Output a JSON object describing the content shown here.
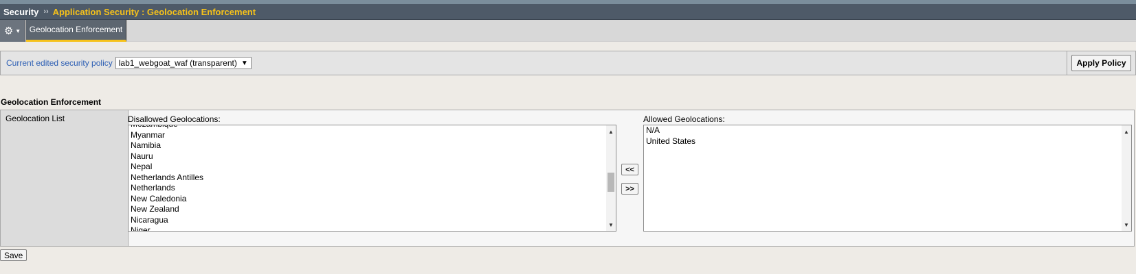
{
  "breadcrumb": {
    "root": "Security",
    "separator": "››",
    "page": "Application Security : Geolocation Enforcement"
  },
  "tabs": {
    "settings_icon": "gear-icon",
    "active_tab": "Geolocation Enforcement"
  },
  "policy": {
    "label": "Current edited security policy",
    "selected": "lab1_webgoat_waf (transparent)",
    "apply_label": "Apply Policy"
  },
  "section": {
    "title": "Geolocation Enforcement",
    "row_label": "Geolocation List"
  },
  "disallowed": {
    "caption": "Disallowed Geolocations:",
    "items": [
      "Mozambique",
      "Myanmar",
      "Namibia",
      "Nauru",
      "Nepal",
      "Netherlands Antilles",
      "Netherlands",
      "New Caledonia",
      "New Zealand",
      "Nicaragua",
      "Niger"
    ],
    "scroll_position": 0.56
  },
  "allowed": {
    "caption": "Allowed Geolocations:",
    "items": [
      "N/A",
      "United States"
    ]
  },
  "buttons": {
    "move_left": "<<",
    "move_right": ">>",
    "save": "Save"
  },
  "colors": {
    "header_bg": "#4e5a68",
    "breadcrumb_accent": "#f6c21a",
    "link_blue": "#2d5fb4",
    "page_bg": "#eeebe6"
  }
}
